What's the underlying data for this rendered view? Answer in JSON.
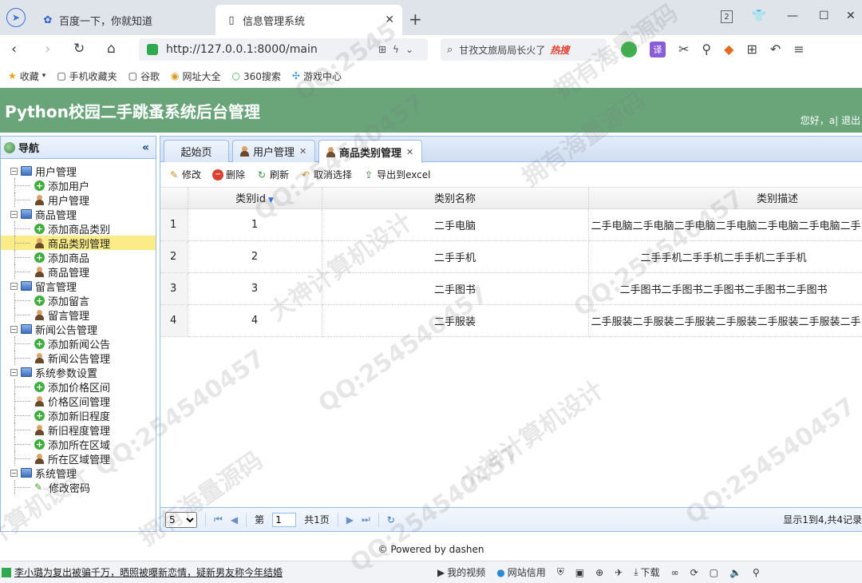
{
  "browser": {
    "tab1_title": "百度一下，你就知道",
    "tab2_title": "信息管理系统",
    "new_tab": "+",
    "window_count": "2",
    "url": "http://127.0.0.1:8000/main",
    "search_text": "甘孜文旅局局长火了",
    "search_hot": "热搜",
    "translate_label": "译"
  },
  "bookmarks": [
    {
      "icon": "★",
      "label": "收藏"
    },
    {
      "icon": "▢",
      "label": "手机收藏夹"
    },
    {
      "icon": "▢",
      "label": "谷歌"
    },
    {
      "icon": "◉",
      "label": "网址大全"
    },
    {
      "icon": "○",
      "label": "360搜索"
    },
    {
      "icon": "✣",
      "label": "游戏中心"
    }
  ],
  "app": {
    "title": "Python校园二手跳蚤系统后台管理",
    "user_info": "您好，a| 退出"
  },
  "nav": {
    "title": "导航",
    "groups": [
      {
        "label": "用户管理",
        "items": [
          "添加用户",
          "用户管理"
        ]
      },
      {
        "label": "商品管理",
        "items": [
          "添加商品类别",
          "商品类别管理",
          "添加商品",
          "商品管理"
        ]
      },
      {
        "label": "留言管理",
        "items": [
          "添加留言",
          "留言管理"
        ]
      },
      {
        "label": "新闻公告管理",
        "items": [
          "添加新闻公告",
          "新闻公告管理"
        ]
      },
      {
        "label": "系统参数设置",
        "items": [
          "添加价格区间",
          "价格区间管理",
          "添加新旧程度",
          "新旧程度管理",
          "添加所在区域",
          "所在区域管理"
        ]
      },
      {
        "label": "系统管理",
        "items": [
          "修改密码"
        ]
      }
    ]
  },
  "tabs": [
    "起始页",
    "用户管理",
    "商品类别管理"
  ],
  "toolbar": {
    "edit": "修改",
    "delete": "删除",
    "refresh": "刷新",
    "cancel_select": "取消选择",
    "export": "导出到excel"
  },
  "grid": {
    "columns": [
      "类别id",
      "类别名称",
      "类别描述"
    ],
    "rows": [
      {
        "no": "1",
        "id": "1",
        "name": "二手电脑",
        "desc": "二手电脑二手电脑二手电脑二手电脑二手电脑二手电脑二手"
      },
      {
        "no": "2",
        "id": "2",
        "name": "二手手机",
        "desc": "二手手机二手手机二手手机二手手机"
      },
      {
        "no": "3",
        "id": "3",
        "name": "二手图书",
        "desc": "二手图书二手图书二手图书二手图书二手图书"
      },
      {
        "no": "4",
        "id": "4",
        "name": "二手服装",
        "desc": "二手服装二手服装二手服装二手服装二手服装二手服装二手"
      }
    ]
  },
  "pager": {
    "page_size": "5",
    "page_prefix": "第",
    "page_value": "1",
    "page_total": "共1页",
    "info": "显示1到4,共4记录"
  },
  "footer": "© Powered by dashen",
  "statusbar": {
    "news": "李小璐为复出被骗千万，晒照被曝新恋情，疑新男友称今年结婚",
    "video": "我的视频",
    "credit": "网站信用",
    "download": "下载"
  },
  "colors": {
    "header_green": "#6aa57a",
    "panel_border": "#99bbe8",
    "selected_row": "#fbec88"
  }
}
